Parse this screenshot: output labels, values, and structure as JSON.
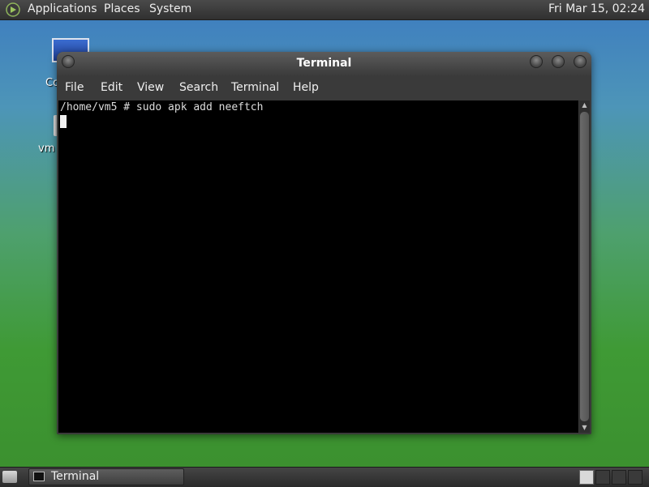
{
  "top_panel": {
    "menus": {
      "applications": "Applications",
      "places": "Places",
      "system": "System"
    },
    "clock": "Fri Mar 15, 02:24",
    "logo_icon": "gnome-foot-icon"
  },
  "desktop": {
    "icons": [
      {
        "label": "Co",
        "icon": "computer-icon"
      },
      {
        "label": "vm",
        "icon": "home-folder-icon"
      }
    ]
  },
  "window": {
    "title": "Terminal",
    "menubar": {
      "file": "File",
      "edit": "Edit",
      "view": "View",
      "search": "Search",
      "terminal": "Terminal",
      "help": "Help"
    },
    "terminal": {
      "line1": "/home/vm5 # sudo apk add neeftch",
      "background": "#000000",
      "foreground": "#dcdcdc"
    }
  },
  "taskbar": {
    "task_label": "Terminal",
    "task_icon": "terminal-icon"
  }
}
